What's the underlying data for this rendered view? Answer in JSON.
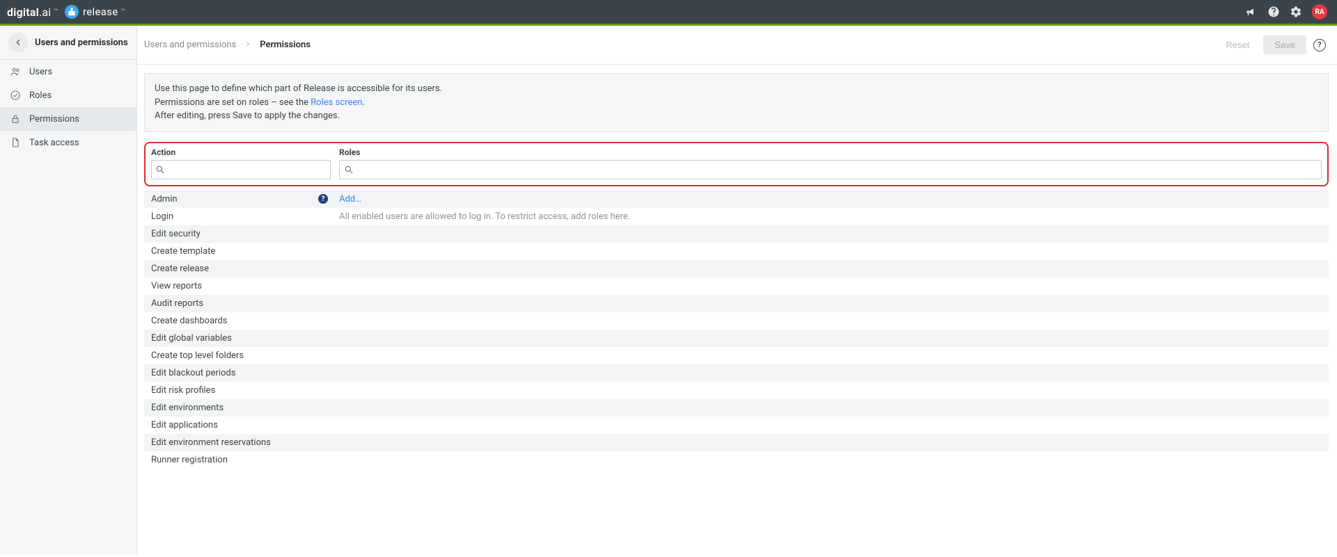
{
  "brand": {
    "logo_main": "digital",
    "logo_suffix": ".ai",
    "tm": "™",
    "release_text": "release",
    "release_tm": "™"
  },
  "header": {
    "avatar_initials": "RA"
  },
  "sidebar": {
    "back_label": "Users and permissions",
    "items": [
      {
        "label": "Users",
        "icon": "users"
      },
      {
        "label": "Roles",
        "icon": "check-circle"
      },
      {
        "label": "Permissions",
        "icon": "lock",
        "active": true
      },
      {
        "label": "Task access",
        "icon": "file"
      }
    ]
  },
  "breadcrumbs": {
    "root": "Users and permissions",
    "current": "Permissions"
  },
  "actions": {
    "reset": "Reset",
    "save": "Save",
    "help": "?"
  },
  "info": {
    "line1": "Use this page to define which part of Release is accessible for its users.",
    "line2_prefix": "Permissions are set on roles – see the ",
    "line2_link": "Roles screen",
    "line2_suffix": ".",
    "line3": "After editing, press Save to apply the changes."
  },
  "filters": {
    "action_label": "Action",
    "roles_label": "Roles"
  },
  "permissions": {
    "add_text": "Add…",
    "login_hint": "All enabled users are allowed to log in. To restrict access, add roles here.",
    "rows": [
      {
        "action": "Admin",
        "has_help": true,
        "roles_type": "add"
      },
      {
        "action": "Login",
        "roles_type": "login"
      },
      {
        "action": "Edit security"
      },
      {
        "action": "Create template"
      },
      {
        "action": "Create release"
      },
      {
        "action": "View reports"
      },
      {
        "action": "Audit reports"
      },
      {
        "action": "Create dashboards"
      },
      {
        "action": "Edit global variables"
      },
      {
        "action": "Create top level folders"
      },
      {
        "action": "Edit blackout periods"
      },
      {
        "action": "Edit risk profiles"
      },
      {
        "action": "Edit environments"
      },
      {
        "action": "Edit applications"
      },
      {
        "action": "Edit environment reservations"
      },
      {
        "action": "Runner registration"
      }
    ]
  }
}
